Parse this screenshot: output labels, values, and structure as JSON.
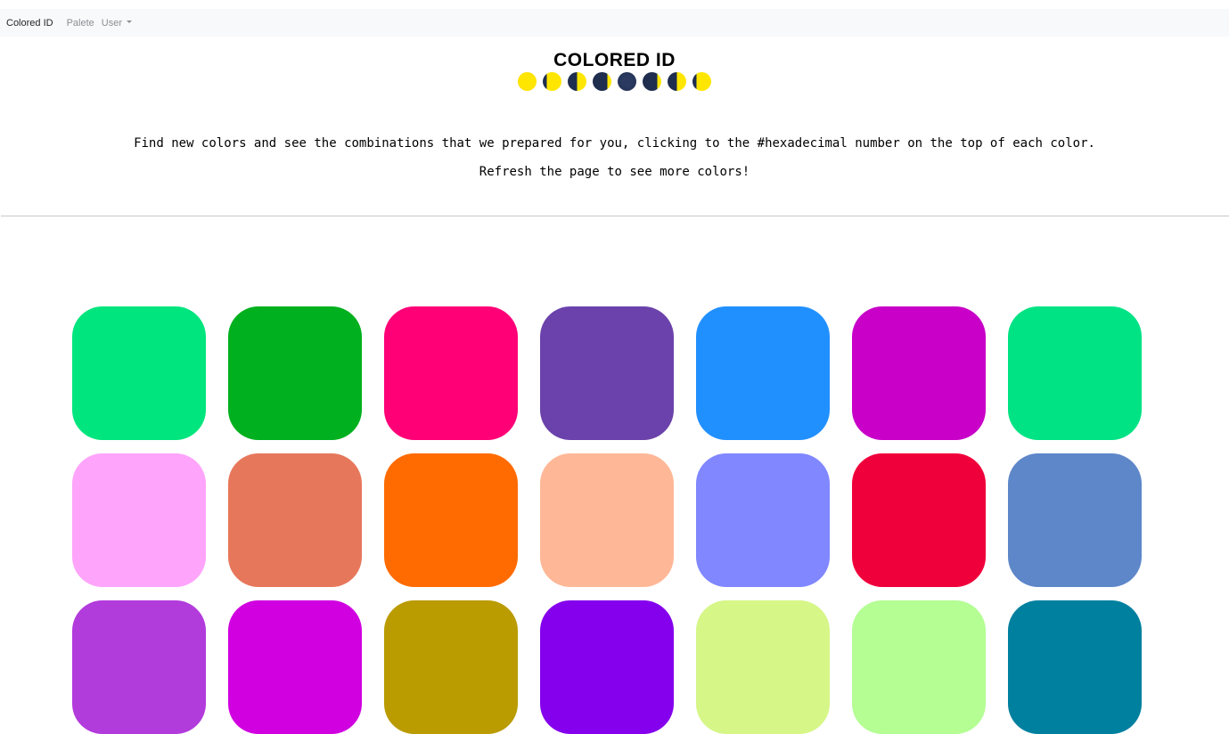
{
  "navbar": {
    "brand": "Colored ID",
    "links": [
      "Palete",
      "User"
    ]
  },
  "header": {
    "title": "COLORED ID",
    "moon_phases": [
      {
        "icon": "full-moon-icon",
        "emoji": "🌕"
      },
      {
        "icon": "waning-gibbous-moon-icon",
        "emoji": "🌖"
      },
      {
        "icon": "last-quarter-moon-icon",
        "emoji": "🌗"
      },
      {
        "icon": "waning-crescent-moon-icon",
        "emoji": "🌘"
      },
      {
        "icon": "new-moon-icon",
        "emoji": "🌑"
      },
      {
        "icon": "waxing-crescent-moon-icon",
        "emoji": "🌒"
      },
      {
        "icon": "first-quarter-moon-icon",
        "emoji": "🌓"
      },
      {
        "icon": "waxing-gibbous-moon-icon",
        "emoji": "🌔"
      }
    ]
  },
  "intro": {
    "line1": "Find new colors and see the combinations that we prepared for you, clicking to the #hexadecimal number on the top of each color.",
    "line2": "Refresh the page to see more colors!"
  },
  "swatches": [
    "#00e57d",
    "#00b01e",
    "#ff0077",
    "#6b42ab",
    "#2190ff",
    "#c800c8",
    "#00e385",
    "#ffa4fb",
    "#e7775b",
    "#ff6b00",
    "#feb897",
    "#8087ff",
    "#f0003b",
    "#5e87c9",
    "#b23bdc",
    "#d000e0",
    "#ba9b00",
    "#8500ec",
    "#d6f688",
    "#b4fe94",
    "#00809f"
  ],
  "colors": {
    "navbar_bg": "#f8f9fa",
    "moon_light": "#ffe600",
    "moon_dark": "#1f2d4e"
  }
}
